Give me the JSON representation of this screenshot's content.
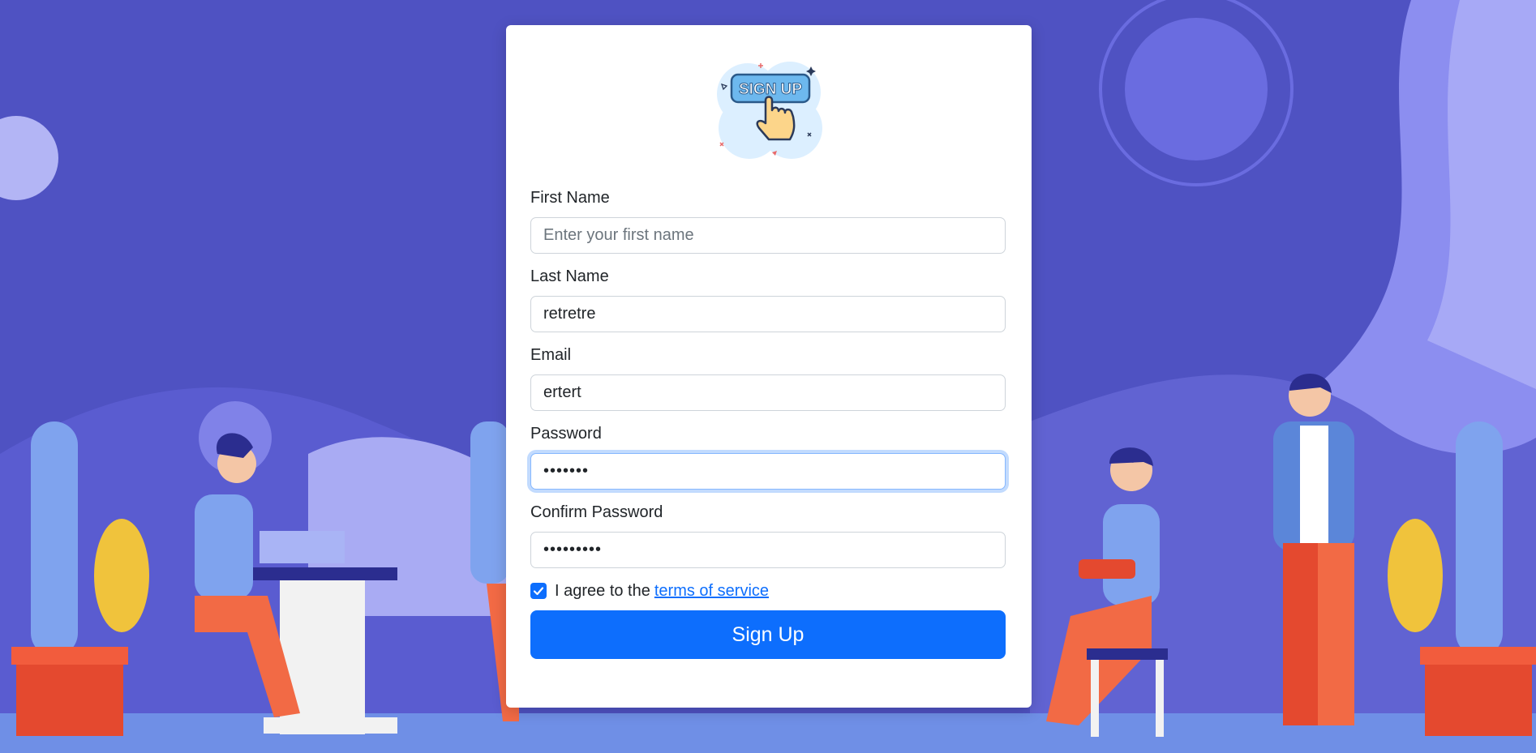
{
  "logo": {
    "text": "SIGN UP",
    "icon": "pointing-hand-icon"
  },
  "form": {
    "first_name": {
      "label": "First Name",
      "placeholder": "Enter your first name",
      "value": ""
    },
    "last_name": {
      "label": "Last Name",
      "value": "retretre"
    },
    "email": {
      "label": "Email",
      "value": "ertert"
    },
    "password": {
      "label": "Password",
      "value": "•••••••"
    },
    "confirm_password": {
      "label": "Confirm Password",
      "value": "•••••••••"
    },
    "terms": {
      "checked": true,
      "text": "I agree to the",
      "link_text": "terms of service"
    },
    "submit_label": "Sign Up"
  },
  "colors": {
    "background": "#4f52c2",
    "primary": "#0d6efd",
    "card": "#ffffff"
  }
}
